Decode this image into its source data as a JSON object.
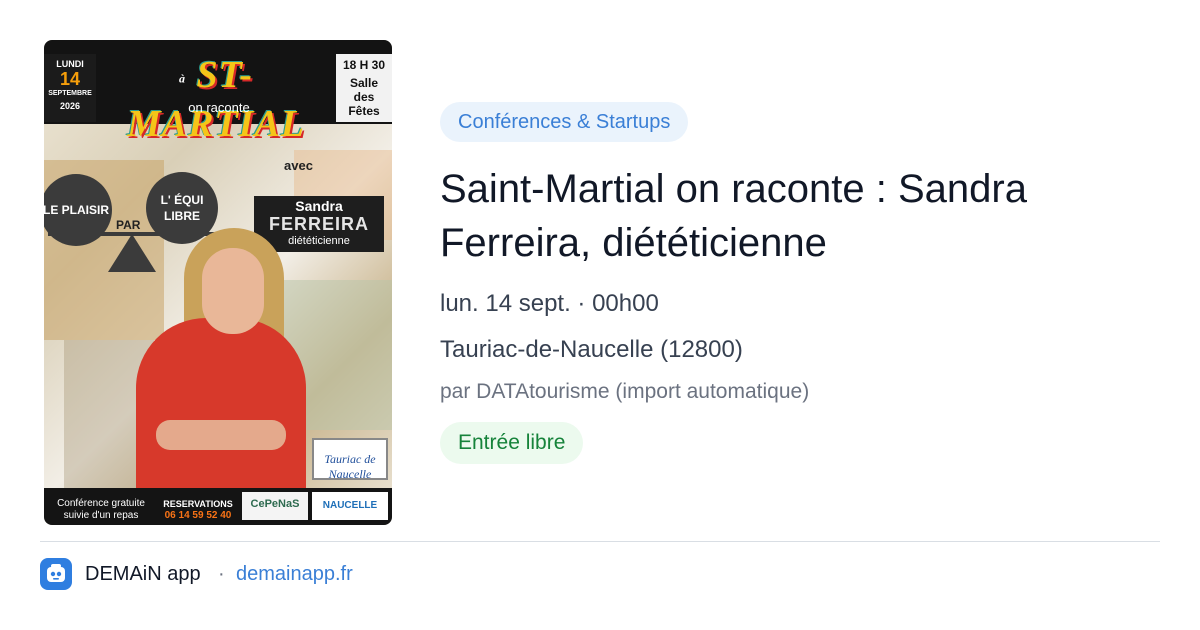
{
  "poster": {
    "date": {
      "weekday": "LUNDI",
      "day": "14",
      "month": "SEPTEMBRE",
      "year": "2026"
    },
    "title_small": "à",
    "title": "ST-MARTIAL",
    "title_sub": "on raconte",
    "time": {
      "hour": "18 H 30",
      "line1": "Salle",
      "line2": "des",
      "line3": "Fêtes"
    },
    "avec": "avec",
    "left_circle": "LE PLAISIR",
    "par": "PAR",
    "right_circle": "L' ÉQUI LIBRE",
    "speaker_first": "Sandra",
    "speaker_last": "FERREIRA",
    "speaker_role": "diététicienne",
    "bottom_left": "Conférence gratuite suivie d'un repas",
    "reservations_label": "RESERVATIONS",
    "reservations_phone": "06 14 59 52 40",
    "logo_cepenas": "CePeNaS",
    "logo_tauriac": "Tauriac de Naucelle",
    "logo_naucelle": "NAUCELLE"
  },
  "category": "Conférences & Startups",
  "event": {
    "title": "Saint-Martial on raconte : Sandra Ferreira, diététicienne",
    "date": "lun. 14 sept. · 00h00",
    "place": "Tauriac-de-Naucelle (12800)",
    "by": "par DATAtourisme (import automatique)",
    "price": "Entrée libre"
  },
  "footer": {
    "app_icon": "robot-icon",
    "app_name": "DEMAiN app",
    "separator": "·",
    "link": "demainapp.fr"
  },
  "colors": {
    "accent": "#3a7fd6",
    "category_bg": "#eaf3fc",
    "price_text": "#16833a",
    "price_bg": "#ecfaee"
  }
}
